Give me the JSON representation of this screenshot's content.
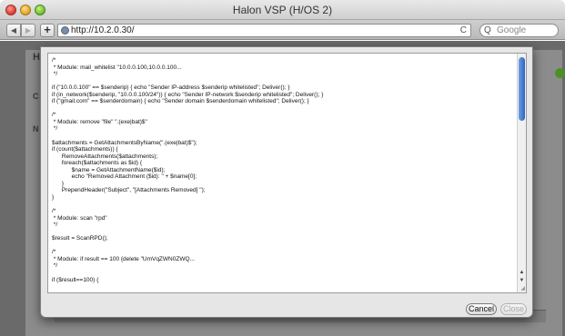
{
  "window": {
    "title": "Halon VSP (H/OS 2)"
  },
  "toolbar": {
    "back_glyph": "◀",
    "forward_glyph": "▶",
    "add_glyph": "+",
    "url": "http://10.2.0.30/",
    "reload_glyph": "C",
    "search_placeholder": "Google",
    "search_glyph": "Q"
  },
  "background_page": {
    "letters": [
      "H",
      "C",
      "N"
    ]
  },
  "editor": {
    "lines": [
      "/*",
      " * Module: mail_whitelist \"10.0.0.100,10.0.0.100...",
      " */",
      "",
      "if (\"10.0.0.100\" == $senderip) { echo \"Sender IP-address $senderip whitelisted\"; Deliver(); }",
      "if (in_network($senderip, \"10.0.0.100/24\")) { echo \"Sender IP-network $senderip whitelisted\"; Deliver(); }",
      "if (\"gmail.com\" == $senderdomain) { echo \"Sender domain $senderdomain whitelisted\"; Deliver(); }",
      "",
      "/*",
      " * Module: remove \"file\" \".(exe|bat)$\"",
      " */",
      "",
      "$attachments = GetAttachmentsByName(\".(exe|bat)$\");",
      "if (count($attachments)) {",
      "      RemoveAttachments($attachments);",
      "      foreach($attachments as $id) {",
      "            $name = GetAttachmentName($id);",
      "            echo \"Removed Attachment ($id): \" + $name[0];",
      "      }",
      "      PrependHeader(\"Subject\", \"[Attachments Removed] \");",
      "}",
      "",
      "/*",
      " * Module: scan \"rpd\"",
      " */",
      "",
      "$result = ScanRPD();",
      "",
      "/*",
      " * Module: if result == 100 {delete \"UmVqZWN0ZWQ...",
      " */",
      "",
      "if ($result==100) {"
    ]
  },
  "buttons": {
    "cancel": "Cancel",
    "close": "Close"
  }
}
